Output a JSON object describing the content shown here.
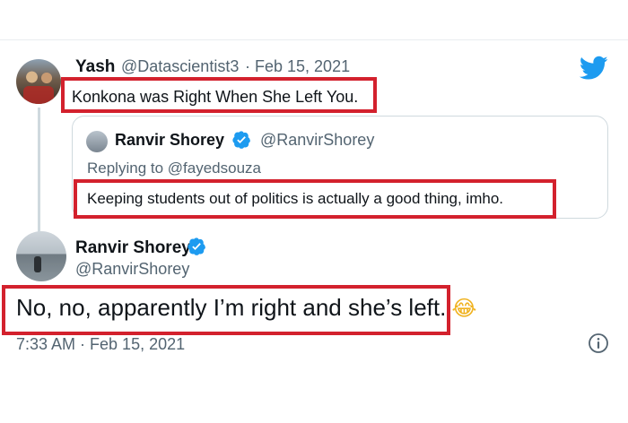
{
  "reply": {
    "name": "Yash",
    "handle": "@Datascientist3",
    "separator": "·",
    "date": "Feb 15, 2021",
    "text": "Konkona was Right When She Left You."
  },
  "quoted": {
    "name": "Ranvir Shorey",
    "handle": "@RanvirShorey",
    "replying_to": "Replying to @fayedsouza",
    "text": "Keeping students out of politics is actually a good thing, imho."
  },
  "main": {
    "name": "Ranvir Shorey",
    "handle": "@RanvirShorey",
    "text": "No, no, apparently I’m right and she’s left.",
    "emoji": "😂",
    "timestamp": "7:33 AM · Feb 15, 2021"
  },
  "icons": {
    "brand": "twitter-bird-icon",
    "verified": "verified-badge-icon",
    "info": "info-icon"
  },
  "colors": {
    "twitter_blue": "#1d9bf0",
    "highlight_red": "#d3212d",
    "secondary_text": "#536471"
  }
}
